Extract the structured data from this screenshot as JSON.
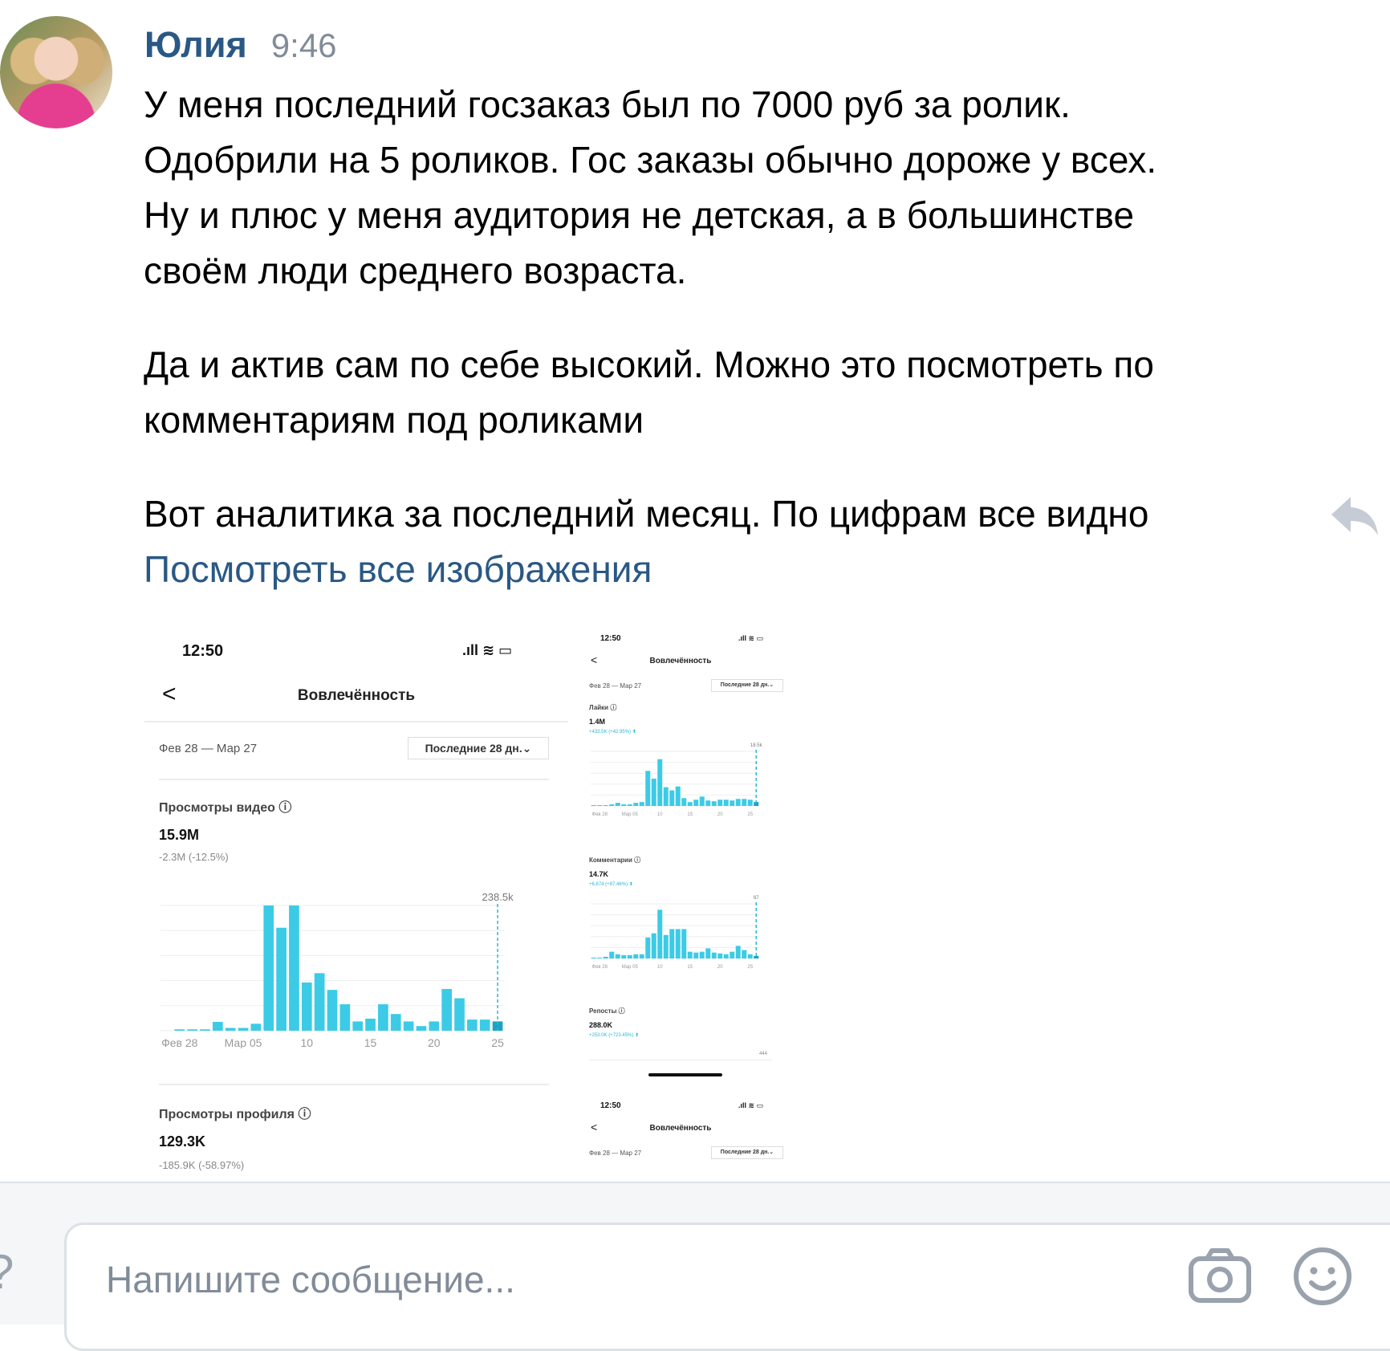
{
  "message": {
    "author": "Юлия",
    "time": "9:46",
    "paragraphs": [
      "У меня последний госзаказ был по 7000 руб за ролик.\nОдобрили на 5 роликов. Гос заказы обычно дороже у всех.\nНу и плюс у меня аудитория не детская, а в большинстве\nсвоём люди среднего возраста.",
      "Да и актив сам по себе высокий. Можно это посмотреть по\nкомментариям под роликами",
      "Вот аналитика за последний месяц. По цифрам все видно"
    ],
    "view_all_images": "Посмотреть все изображения"
  },
  "attachments": {
    "big": {
      "status_time": "12:50",
      "status_icons": ".ıll ≋ ▭",
      "back": "<",
      "title": "Вовлечённость",
      "date_range": "Фев 28 — Мар 27",
      "period": "Последние 28 дн.⌄",
      "video_views": {
        "label": "Просмотры видео ⓘ",
        "value": "15.9M",
        "change": "-2.3M (-12.5%)"
      },
      "profile_views": {
        "label": "Просмотры профиля ⓘ",
        "value": "129.3K",
        "change": "-185.9K (-58.97%)"
      }
    },
    "small": {
      "status_time": "12:50",
      "status_icons": ".ıll ≋ ▭",
      "back": "<",
      "title": "Вовлечённость",
      "date_range": "Фев 28 — Мар 27",
      "period": "Последние 28 дн.⌄",
      "likes": {
        "label": "Лайки ⓘ",
        "value": "1.4M",
        "change": "+433.5K (+42.95%) ⬆"
      },
      "comments": {
        "label": "Комментарии ⓘ",
        "value": "14.7K",
        "change": "+6,874 (+87.46%) ⬆"
      },
      "reposts": {
        "label": "Репосты ⓘ",
        "value": "288.0K",
        "change": "+253.0K (+723.45%) ⬆",
        "peak": "444"
      },
      "second": {
        "status_time": "12:50",
        "status_icons": ".ıll ≋ ▭",
        "back": "<",
        "title": "Вовлечённость",
        "date_range": "Фев 28 — Мар 27",
        "period": "Последние 28 дн.⌄"
      }
    }
  },
  "chart_data": [
    {
      "type": "bar",
      "title": "Просмотры видео",
      "x_tick_labels": [
        "Фев 28",
        "Мар 05",
        "10",
        "15",
        "20",
        "25"
      ],
      "peak_label": "238.5k",
      "ylim": [
        0,
        270
      ],
      "color": "#3ccbe6",
      "values": [
        0,
        3,
        3,
        3,
        19,
        6,
        6,
        15,
        270,
        222,
        270,
        104,
        124,
        88,
        57,
        20,
        26,
        57,
        36,
        20,
        10,
        20,
        90,
        70,
        24,
        24,
        20
      ]
    },
    {
      "type": "bar",
      "title": "Лайки",
      "x_tick_labels": [
        "Фев 28",
        "Мар 05",
        "10",
        "15",
        "20",
        "25"
      ],
      "peak_label": "18.5k",
      "ylim": [
        0,
        70
      ],
      "color": "#3ccbe6",
      "values": [
        1,
        1,
        1,
        2,
        4,
        2,
        2,
        4,
        5,
        45,
        35,
        60,
        24,
        20,
        25,
        10,
        5,
        8,
        12,
        7,
        6,
        8,
        8,
        7,
        9,
        9,
        8,
        5
      ]
    },
    {
      "type": "bar",
      "title": "Комментарии",
      "x_tick_labels": [
        "Фев 28",
        "Мар 05",
        "10",
        "15",
        "20",
        "25"
      ],
      "peak_label": "87",
      "ylim": [
        0,
        65
      ],
      "color": "#3ccbe6",
      "values": [
        1,
        1,
        2,
        8,
        5,
        4,
        4,
        5,
        5,
        25,
        30,
        58,
        28,
        35,
        35,
        35,
        8,
        7,
        8,
        12,
        7,
        6,
        5,
        8,
        15,
        10,
        5,
        3
      ]
    }
  ],
  "composer": {
    "placeholder": "Напишите сообщение..."
  },
  "icons": {
    "reply": "reply-arrow-icon",
    "camera": "camera-icon",
    "smile": "smile-icon",
    "info": "info-icon",
    "back": "chevron-left-icon"
  },
  "colors": {
    "link": "#2a5885",
    "muted": "#818c99",
    "bar": "#3ccbe6",
    "border": "#dce1e6"
  }
}
